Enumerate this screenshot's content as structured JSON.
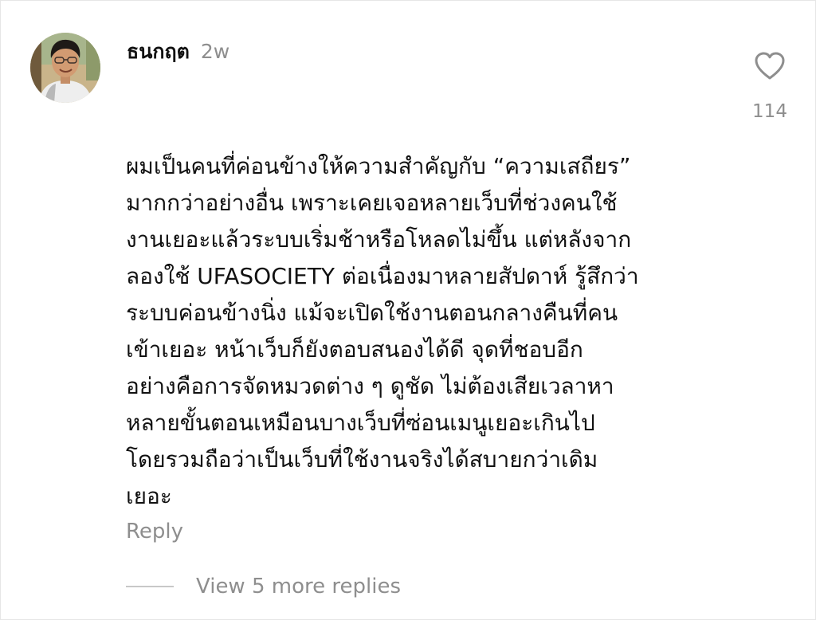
{
  "comment": {
    "author": "ธนกฤต",
    "timestamp": "2w",
    "like_count": "114",
    "body_lines": [
      "ผมเป็นคนที่ค่อนข้างให้ความสำคัญกับ “ความเสถียร”",
      "มากกว่าอย่างอื่น เพราะเคยเจอหลายเว็บที่ช่วงคนใช้",
      "งานเยอะแล้วระบบเริ่มช้าหรือโหลดไม่ขึ้น แต่หลังจาก",
      "ลองใช้ UFASOCIETY ต่อเนื่องมาหลายสัปดาห์ รู้สึกว่า",
      "ระบบค่อนข้างนิ่ง แม้จะเปิดใช้งานตอนกลางคืนที่คน",
      "เข้าเยอะ หน้าเว็บก็ยังตอบสนองได้ดี จุดที่ชอบอีก",
      "อย่างคือการจัดหมวดต่าง ๆ ดูชัด ไม่ต้องเสียเวลาหา",
      "หลายขั้นตอนเหมือนบางเว็บที่ซ่อนเมนูเยอะเกินไป",
      "โดยรวมถือว่าเป็นเว็บที่ใช้งานจริงได้สบายกว่าเดิม",
      "เยอะ"
    ],
    "reply_label": "Reply",
    "view_replies_label": "View 5 more replies",
    "like_icon": "heart-outline-icon"
  },
  "colors": {
    "text_primary": "#111111",
    "text_secondary": "#8e8e8e",
    "divider": "#c8c8c8"
  }
}
